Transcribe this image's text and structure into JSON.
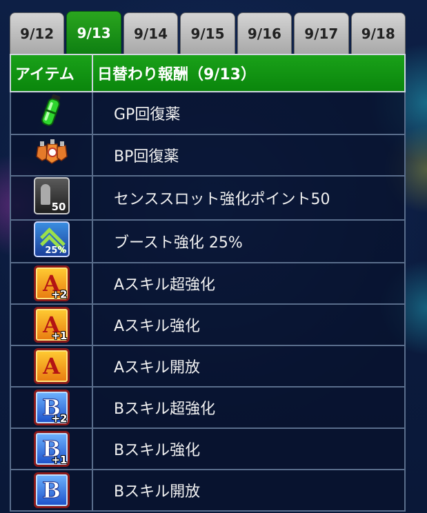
{
  "tabs": [
    "9/12",
    "9/13",
    "9/14",
    "9/15",
    "9/16",
    "9/17",
    "9/18"
  ],
  "active_tab": "9/13",
  "table": {
    "col_item": "アイテム",
    "col_reward": "日替わり報酬（9/13）"
  },
  "rows": [
    {
      "name": "GP回復薬",
      "icon": "gp-potion-icon"
    },
    {
      "name": "BP回復薬",
      "icon": "bp-potion-icon"
    },
    {
      "name": "センススロット強化ポイント50",
      "icon": "sense-slot-icon",
      "icon_text": "50"
    },
    {
      "name": "ブースト強化 25%",
      "icon": "boost-icon",
      "icon_text": "25%"
    },
    {
      "name": "Aスキル超強化",
      "icon": "a-skill-icon",
      "icon_text": "A",
      "plus": "+2"
    },
    {
      "name": "Aスキル強化",
      "icon": "a-skill-icon",
      "icon_text": "A",
      "plus": "+1"
    },
    {
      "name": "Aスキル開放",
      "icon": "a-skill-icon",
      "icon_text": "A",
      "plus": ""
    },
    {
      "name": "Bスキル超強化",
      "icon": "b-skill-icon",
      "icon_text": "B",
      "plus": "+2"
    },
    {
      "name": "Bスキル強化",
      "icon": "b-skill-icon",
      "icon_text": "B",
      "plus": "+1"
    },
    {
      "name": "Bスキル開放",
      "icon": "b-skill-icon",
      "icon_text": "B",
      "plus": ""
    }
  ],
  "colors": {
    "tab_active": "#1a9a17",
    "header_green": "#12941a",
    "tab_inactive": "#bdbdbd"
  }
}
